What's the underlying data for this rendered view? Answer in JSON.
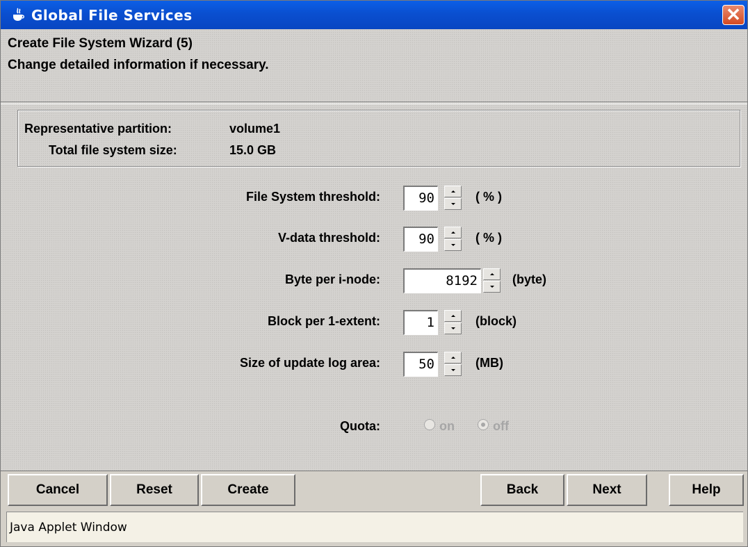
{
  "window": {
    "title": "Global File Services",
    "close_label": "✕"
  },
  "header": {
    "line1": "Create File System Wizard (5)",
    "line2": "Change detailed information if necessary."
  },
  "info": {
    "partition_label": "Representative partition:",
    "partition_value": "volume1",
    "size_label": "Total file system size:",
    "size_value": "15.0 GB"
  },
  "fields": {
    "fs_threshold": {
      "label": "File System threshold:",
      "value": "90",
      "unit": "( % )"
    },
    "vdata_threshold": {
      "label": "V-data threshold:",
      "value": "90",
      "unit": "( % )"
    },
    "byte_per_inode": {
      "label": "Byte per i-node:",
      "value": "8192",
      "unit": "(byte)"
    },
    "block_per_extent": {
      "label": "Block per 1-extent:",
      "value": "1",
      "unit": "(block)"
    },
    "update_log_size": {
      "label": "Size of update log area:",
      "value": "50",
      "unit": "(MB)"
    }
  },
  "quota": {
    "label": "Quota:",
    "on_label": "on",
    "off_label": "off",
    "selected": "off",
    "enabled": false
  },
  "buttons": {
    "cancel": "Cancel",
    "reset": "Reset",
    "create": "Create",
    "back": "Back",
    "next": "Next",
    "help": "Help"
  },
  "status_bar": {
    "text": "Java Applet Window"
  },
  "colors": {
    "titlebar": "#0a4fd0",
    "close_button": "#d44a22",
    "disabled_text": "#a6a6a6"
  }
}
